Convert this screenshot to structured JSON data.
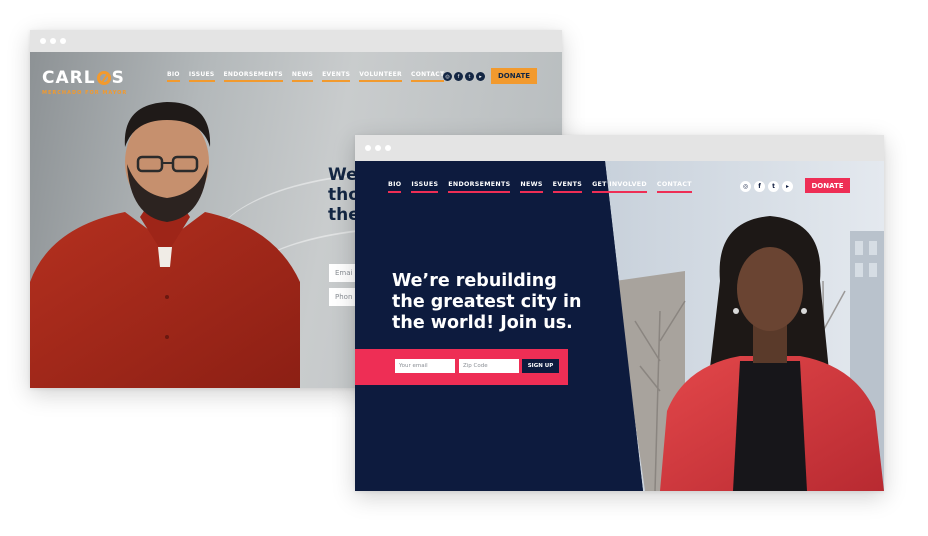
{
  "back_site": {
    "logo": {
      "name": "CARLOS",
      "tagline": "MERCHADO FOR MAYOR"
    },
    "nav": [
      "BIO",
      "ISSUES",
      "ENDORSEMENTS",
      "NEWS",
      "EVENTS",
      "VOLUNTEER",
      "CONTACT"
    ],
    "social_icons": [
      "instagram-icon",
      "facebook-icon",
      "twitter-icon",
      "youtube-icon"
    ],
    "donate_label": "DONATE",
    "headline_visible": [
      "We",
      "tho",
      "the"
    ],
    "inputs": [
      {
        "placeholder": "Emai"
      },
      {
        "placeholder": "Phon"
      }
    ],
    "accent_color": "#f29a2e",
    "navy_color": "#142744"
  },
  "front_site": {
    "nav": [
      "BIO",
      "ISSUES",
      "ENDORSEMENTS",
      "NEWS",
      "EVENTS",
      "GET INVOLVED",
      "CONTACT"
    ],
    "social_icons": [
      "instagram-icon",
      "facebook-icon",
      "twitter-icon",
      "youtube-icon"
    ],
    "donate_label": "DONATE",
    "headline": [
      "We’re rebuilding",
      "the greatest city in",
      "the world! Join us."
    ],
    "inputs": [
      {
        "placeholder": "Your email"
      },
      {
        "placeholder": "Zip Code"
      }
    ],
    "signup_label": "SIGN UP",
    "accent_color": "#ee2e55",
    "navy_color": "#0d1b3e"
  }
}
